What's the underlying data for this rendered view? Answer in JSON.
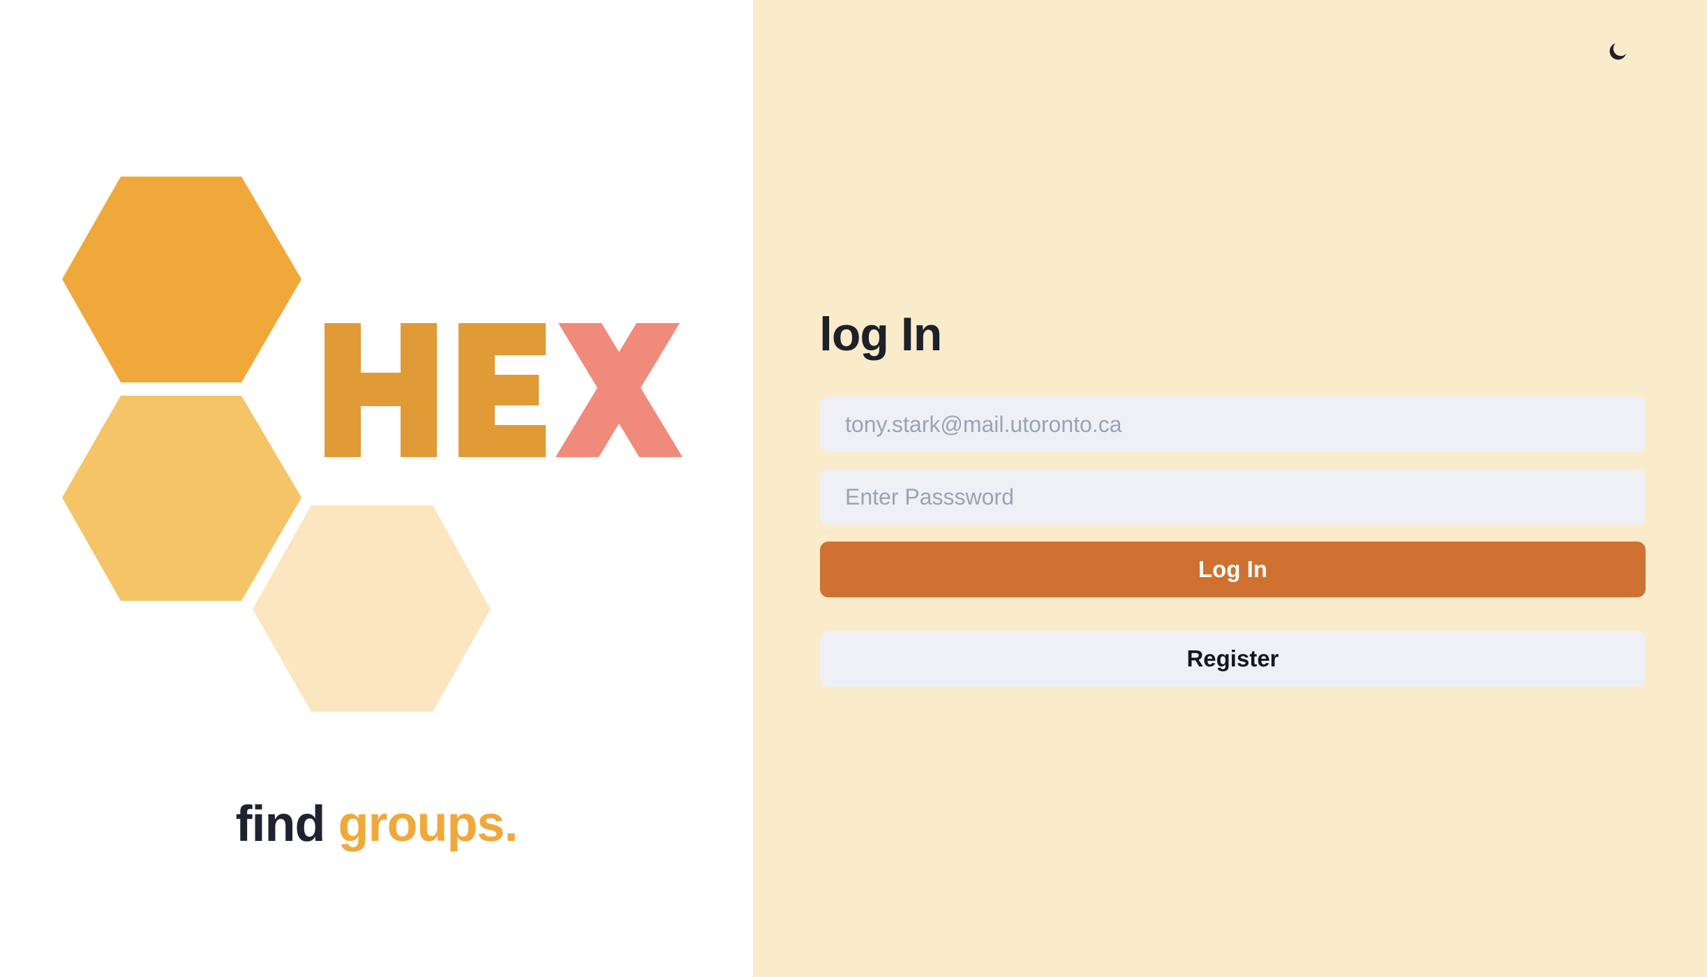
{
  "brand": {
    "logo_text": "HEX",
    "tagline_part1": "find",
    "tagline_part2": "groups."
  },
  "colors": {
    "hex_dark": "#f0a83a",
    "hex_mid": "#f4c466",
    "hex_light": "#fbe6bf",
    "logo_he": "#e09b36",
    "logo_x": "#f08a7b",
    "right_bg": "#faebcb",
    "primary_button": "#cf7131",
    "field_bg": "#eef0f5"
  },
  "header": {
    "theme_toggle_icon": "moon-icon"
  },
  "login": {
    "title": "log In",
    "email_placeholder": "tony.stark@mail.utoronto.ca",
    "password_placeholder": "Enter Passsword",
    "login_label": "Log In",
    "register_label": "Register"
  }
}
